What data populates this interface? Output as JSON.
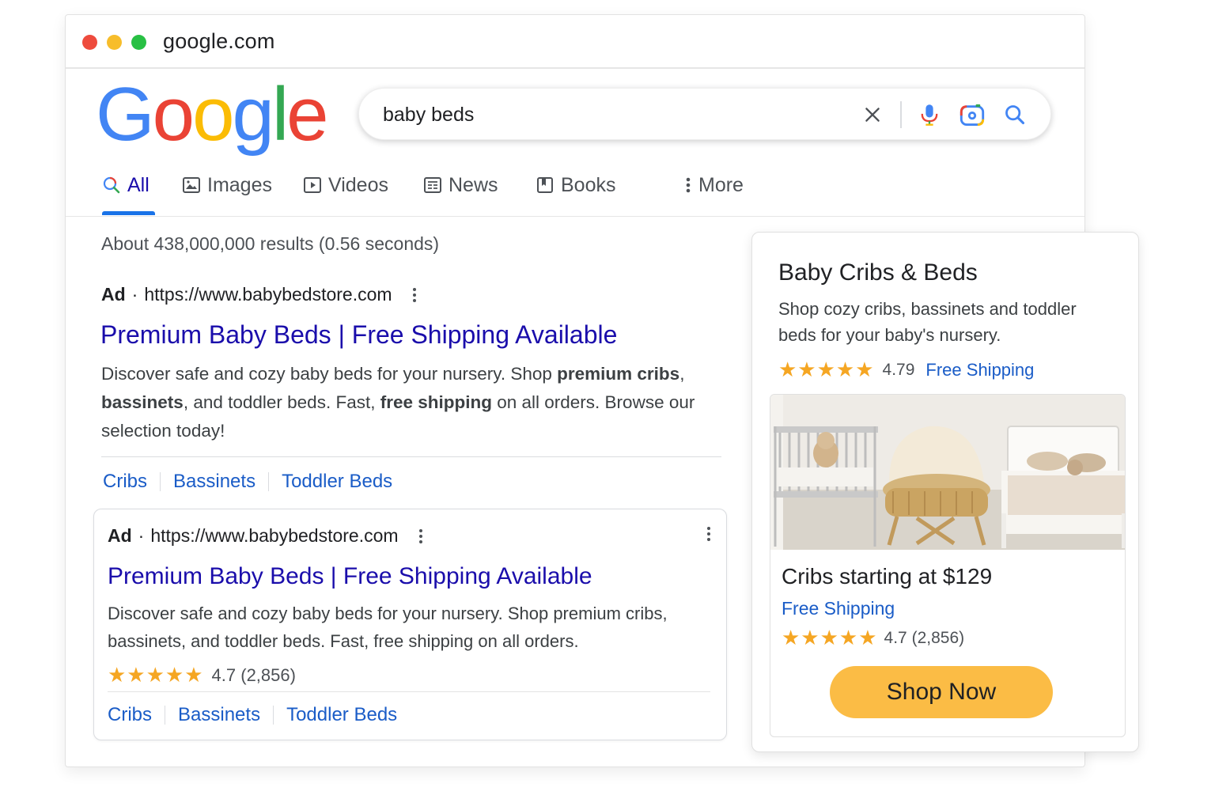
{
  "browser": {
    "url": "google.com"
  },
  "logo": {
    "letters": [
      "G",
      "o",
      "o",
      "g",
      "l",
      "e"
    ]
  },
  "colors": {
    "blue": "#4285F4",
    "red": "#EA4335",
    "yellow": "#FBBC05",
    "green": "#34A853",
    "link": "#1a0dab",
    "button": "#fbbc45",
    "star": "#f5a623"
  },
  "search": {
    "query": "baby beds",
    "icons": [
      "close-icon",
      "microphone-icon",
      "lens-camera-icon",
      "search-icon"
    ]
  },
  "tabs": [
    {
      "label": "All",
      "icon": "search-icon",
      "active": true
    },
    {
      "label": "Images",
      "icon": "image-icon"
    },
    {
      "label": "Videos",
      "icon": "video-icon"
    },
    {
      "label": "News",
      "icon": "news-icon"
    },
    {
      "label": "Books",
      "icon": "book-icon"
    },
    {
      "label": "More",
      "icon": "more-vertical-icon"
    }
  ],
  "results": {
    "stats": "About 438,000,000 results (0.56 seconds)"
  },
  "ad1": {
    "ad_label": "Ad",
    "url": "https://www.babybedstore.com",
    "title": "Premium Baby Beds | Free Shipping Available",
    "desc_1": "Discover safe and cozy baby beds for your nursery. Shop ",
    "desc_bold_1": "premium cribs",
    "desc_2": ", ",
    "desc_bold_2": "bassinets",
    "desc_3": ", and toddler beds. Fast, ",
    "desc_bold_3": "free shipping",
    "desc_4": " on all orders. Browse our selection today!",
    "sitelinks": [
      "Cribs",
      "Bassinets",
      "Toddler Beds"
    ]
  },
  "ad2": {
    "ad_label": "Ad",
    "url": "https://www.babybedstore.com",
    "title": "Premium Baby Beds | Free Shipping Available",
    "desc": "Discover safe and cozy baby beds for your nursery. Shop premium cribs, bassinets, and toddler beds. Fast, free shipping on all orders.",
    "stars": "★★★★★",
    "rating": "4.7 (2,856)",
    "sitelinks": [
      "Cribs",
      "Bassinets",
      "Toddler Beds"
    ]
  },
  "panel": {
    "title": "Baby Cribs & Beds",
    "desc": "Shop cozy cribs, bassinets and toddler beds for your baby's nursery.",
    "stars": "★★★★★",
    "rating": "4.79",
    "shipping": "Free Shipping",
    "card": {
      "title": "Cribs starting at $129",
      "shipping": "Free Shipping",
      "stars": "★★★★★",
      "rating": "4.7 (2,856)",
      "button": "Shop Now"
    }
  }
}
